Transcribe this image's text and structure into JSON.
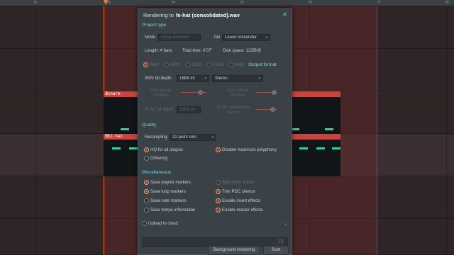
{
  "ruler": {
    "ticks": [
      "72",
      "73",
      "74",
      "75",
      "76",
      "77",
      "78"
    ]
  },
  "tracks": [
    {
      "name": "snare",
      "icon": "pattern-icon"
    },
    {
      "name": "hi-hat",
      "icon": "pattern-icon"
    }
  ],
  "dialog": {
    "title_prefix": "Rendering to",
    "filename": "hi-hat (consolidated).wav",
    "close": "✕",
    "project_type": {
      "heading": "Project type",
      "mode_label": "Mode",
      "mode_value": "Song selection",
      "tail_label": "Tail",
      "tail_value": "Leave remainder",
      "length": "Length: 4 bars",
      "total_time": "Total time: 0'07\"",
      "disk_space": "Disk space: 1235KB"
    },
    "output_format": {
      "heading": "Output format",
      "formats": [
        "WAV",
        "MP3",
        "OGG",
        "FLAC",
        "MIDI"
      ],
      "selected_format": "WAV",
      "wav_bit_depth_label": "WAV bit depth",
      "wav_bit_depth_value": "16Bit int",
      "channels_value": "Stereo",
      "mp3_bitrate_label": "MP3 bitrate",
      "mp3_bitrate_value": "160Kbps",
      "ogg_bitrate_label": "OGG bitrate",
      "ogg_bitrate_value": "160Kbps",
      "flac_bit_depth_label": "FLAC bit depth",
      "flac_bit_depth_value": "16Bit int",
      "flac_compression_label": "FLAC compression",
      "flac_compression_value": "level 5"
    },
    "quality": {
      "heading": "Quality",
      "resampling_label": "Resampling",
      "resampling_value": "32-point sinc",
      "hq_all_plugins": "HQ for all plugins",
      "disable_max_polyphony": "Disable maximum polyphony",
      "dithering": "Dithering"
    },
    "misc": {
      "heading": "Miscellaneous",
      "save_playlist_markers": "Save playlist markers",
      "split_mixer_tracks": "Split mixer tracks",
      "save_loop_markers": "Save loop markers",
      "trim_pdc_silence": "Trim PDC silence",
      "save_note_markers": "Save note markers",
      "enable_insert_effects": "Enable insert effects",
      "save_tempo_information": "Save tempo information",
      "enable_master_effects": "Enable master effects"
    },
    "upload_to_cloud": "Upload to cloud",
    "value_readout": "76",
    "background_rendering": "Background rendering",
    "start": "Start"
  },
  "colors": {
    "accent": "#ff7a4a",
    "heading": "#6fd5dc",
    "clip": "#c9443c",
    "note": "#2fd39a"
  }
}
